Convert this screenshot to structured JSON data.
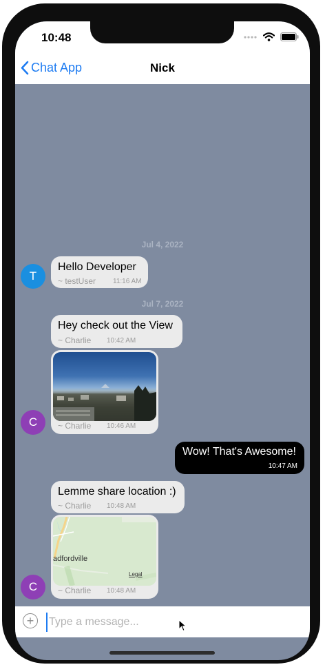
{
  "status_bar": {
    "time": "10:48"
  },
  "nav": {
    "back_label": "Chat App",
    "title": "Nick"
  },
  "conversation": {
    "date_1": "Jul 4, 2022",
    "msg_1": {
      "avatar": "T",
      "text": "Hello Developer",
      "sender": "~ testUser",
      "time": "11:16 AM"
    },
    "date_2": "Jul 7, 2022",
    "msg_2": {
      "text": "Hey check out the View",
      "sender": "~ Charlie",
      "time": "10:42 AM"
    },
    "msg_3": {
      "avatar": "C",
      "sender": "~ Charlie",
      "time": "10:46 AM"
    },
    "msg_4": {
      "text": "Wow! That's Awesome!",
      "time": "10:47 AM"
    },
    "msg_5": {
      "text": "Lemme share location :)",
      "sender": "~ Charlie",
      "time": "10:48 AM"
    },
    "msg_6": {
      "avatar": "C",
      "sender": "~ Charlie",
      "time": "10:48 AM",
      "map_place": "adfordville",
      "map_legal": "Legal"
    }
  },
  "input": {
    "placeholder": "Type a message..."
  },
  "colors": {
    "chat_background": "#7f8ba0",
    "accent": "#1e7cf2",
    "avatar_t": "#1a8fe0",
    "avatar_c": "#8e3fb5",
    "incoming_bubble": "#ebebeb",
    "outgoing_bubble": "#000000"
  }
}
